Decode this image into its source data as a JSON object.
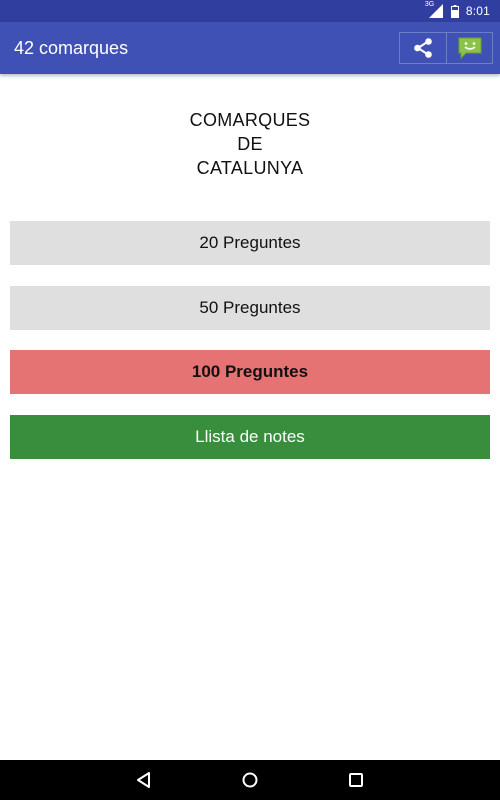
{
  "status_bar": {
    "network_label": "3G",
    "time": "8:01"
  },
  "app_bar": {
    "title": "42 comarques",
    "actions": [
      {
        "icon": "share-icon"
      },
      {
        "icon": "chat-smile-icon"
      }
    ]
  },
  "main": {
    "headline": [
      "COMARQUES",
      "DE",
      "CATALUNYA"
    ],
    "buttons": {
      "q20": "20 Preguntes",
      "q50": "50 Preguntes",
      "q100": "100 Preguntes",
      "notes": "Llista de notes"
    }
  },
  "nav_bar": {
    "icons": [
      "back-icon",
      "home-icon",
      "recents-icon"
    ]
  },
  "colors": {
    "status_bar": "#303f9f",
    "app_bar": "#3f51b5",
    "button_neutral": "#dfdfdf",
    "button_selected": "#e57373",
    "button_notes": "#388e3c",
    "chat_icon": "#8bc34a"
  }
}
